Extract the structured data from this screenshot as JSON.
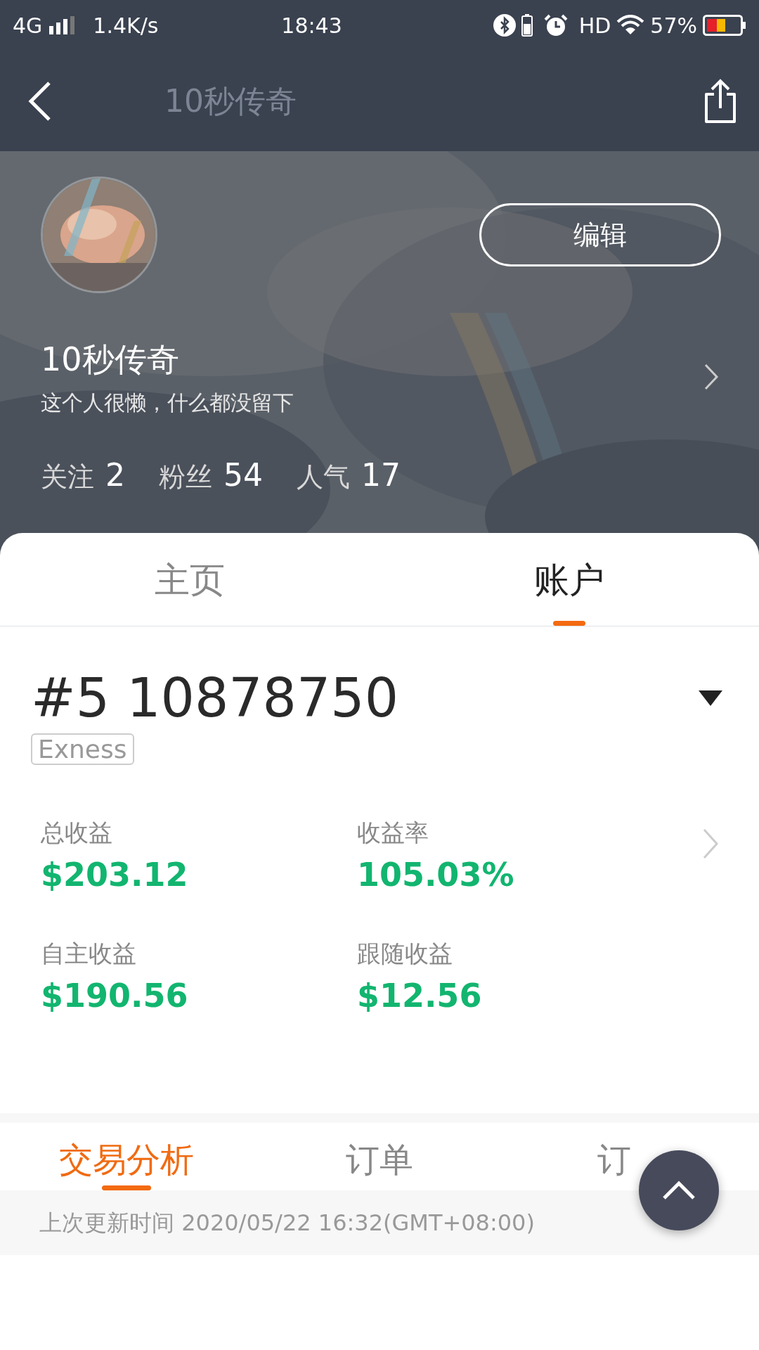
{
  "status_bar": {
    "network": "4G",
    "speed": "1.4K/s",
    "time": "18:43",
    "hd": "HD",
    "battery": "57%"
  },
  "header": {
    "title": "10秒传奇"
  },
  "profile": {
    "edit_button": "编辑",
    "name": "10秒传奇",
    "bio": "这个人很懒，什么都没留下",
    "stats": [
      {
        "label": "关注",
        "value": "2"
      },
      {
        "label": "粉丝",
        "value": "54"
      },
      {
        "label": "人气",
        "value": "17"
      }
    ]
  },
  "tabs": [
    {
      "label": "主页",
      "selected": false
    },
    {
      "label": "账户",
      "selected": true
    }
  ],
  "account": {
    "number": "#5 10878750",
    "broker": "Exness",
    "metrics": [
      {
        "label": "总收益",
        "value": "$203.12"
      },
      {
        "label": "收益率",
        "value": "105.03%"
      },
      {
        "label": "自主收益",
        "value": "$190.56"
      },
      {
        "label": "跟随收益",
        "value": "$12.56"
      }
    ]
  },
  "sub_tabs": [
    {
      "label": "交易分析",
      "selected": true
    },
    {
      "label": "订单",
      "selected": false
    },
    {
      "label": "订",
      "selected": false
    }
  ],
  "updated": "上次更新时间 2020/05/22 16:32(GMT+08:00)"
}
